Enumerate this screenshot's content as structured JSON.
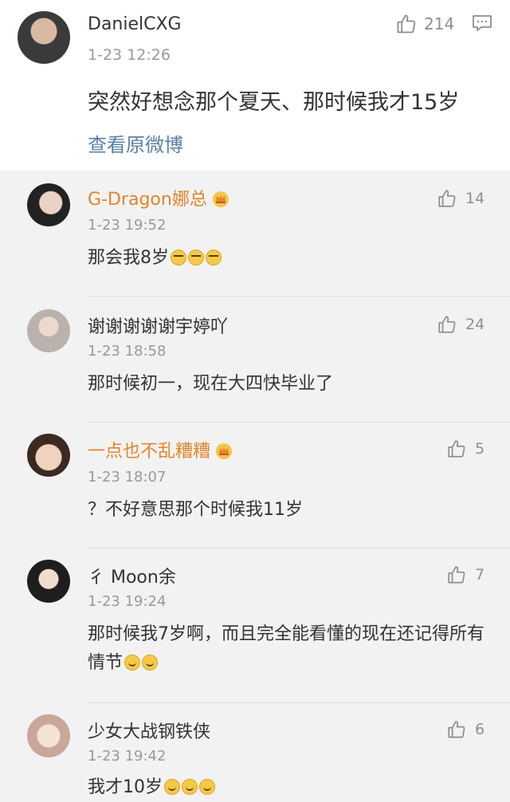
{
  "main_comment": {
    "username": "DanielCXG",
    "time": "1-23 12:26",
    "text": "突然好想念那个夏天、那时候我才15岁",
    "view_original": "查看原微博",
    "likes": "214"
  },
  "replies": [
    {
      "username": "G-Dragon娜总",
      "time": "1-23 19:52",
      "text": "那会我8岁",
      "likes": "14"
    },
    {
      "username": "谢谢谢谢谢宇婷吖",
      "time": "1-23 18:58",
      "text": "那时候初一，现在大四快毕业了",
      "likes": "24"
    },
    {
      "username": "一点也不乱糟糟",
      "time": "1-23 18:07",
      "text": "？不好意思那个时候我11岁",
      "likes": "5"
    },
    {
      "username": "彳 Moon余",
      "time": "1-23 19:24",
      "text": "那时候我7岁啊，而且完全能看懂的现在还记得所有情节",
      "likes": "7"
    },
    {
      "username": "少女大战钢铁侠",
      "time": "1-23 19:42",
      "text": "我才10岁",
      "likes": "6"
    }
  ],
  "colors": {
    "vip_name": "#e0862b",
    "link": "#5b7fa8",
    "meta": "#999999"
  },
  "icons": {
    "like": "thumbs-up-icon",
    "comment": "comment-bubble-icon",
    "vip": "crown-icon",
    "emoji": "emoji-icon"
  }
}
